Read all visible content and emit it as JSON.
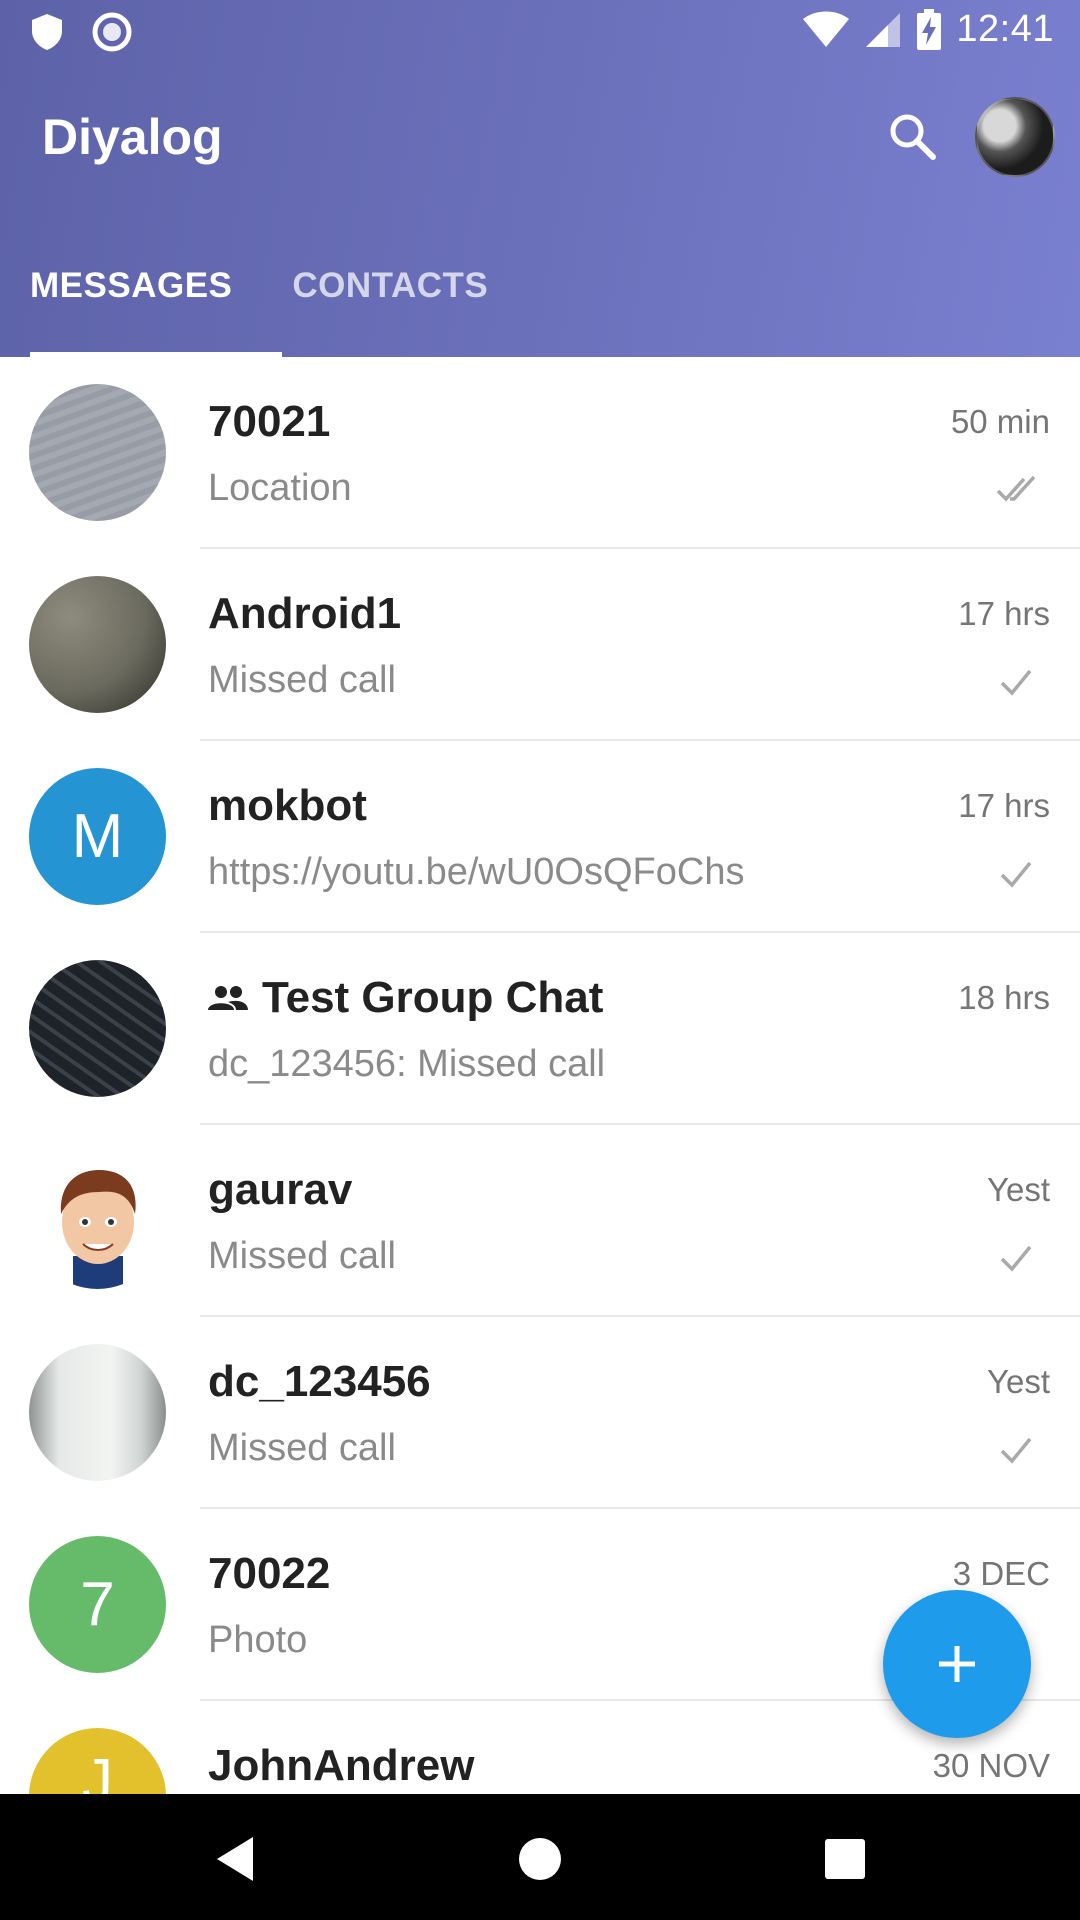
{
  "status_bar": {
    "time": "12:41",
    "left_icons": [
      "shield-icon",
      "record-icon"
    ],
    "right_icons": [
      "wifi-icon",
      "signal-icon",
      "battery-charging-icon"
    ]
  },
  "app_bar": {
    "title": "Diyalog",
    "search_icon": "search-icon",
    "colors": {
      "gradient_start": "#5d62a8",
      "gradient_end": "#7a80d0"
    }
  },
  "tabs": [
    {
      "label": "MESSAGES",
      "active": true
    },
    {
      "label": "CONTACTS",
      "active": false
    }
  ],
  "conversations": [
    {
      "name": "70021",
      "time": "50 min",
      "preview": "Location",
      "status": "double-check",
      "avatar_type": "photo",
      "avatar_letter": "",
      "avatar_color": "#9ea3ad"
    },
    {
      "name": "Android1",
      "time": "17 hrs",
      "preview": "Missed call",
      "status": "check",
      "avatar_type": "photo",
      "avatar_letter": "",
      "avatar_color": "#6b6a5e"
    },
    {
      "name": "mokbot",
      "time": "17 hrs",
      "preview": "https://youtu.be/wU0OsQFoChs",
      "status": "check",
      "avatar_type": "letter",
      "avatar_letter": "M",
      "avatar_color": "#2494d3"
    },
    {
      "name": "Test Group Chat",
      "time": "18 hrs",
      "preview": "dc_123456: Missed call",
      "status": "none",
      "is_group": true,
      "avatar_type": "photo",
      "avatar_letter": "",
      "avatar_color": "#2b2f37"
    },
    {
      "name": "gaurav",
      "time": "Yest",
      "preview": "Missed call",
      "status": "check",
      "avatar_type": "cartoon",
      "avatar_letter": "",
      "avatar_color": "#ffffff"
    },
    {
      "name": "dc_123456",
      "time": "Yest",
      "preview": "Missed call",
      "status": "check",
      "avatar_type": "photo",
      "avatar_letter": "",
      "avatar_color": "#c9cdcc"
    },
    {
      "name": "70022",
      "time": "3 DEC",
      "preview": "Photo",
      "status": "none",
      "avatar_type": "letter",
      "avatar_letter": "7",
      "avatar_color": "#66bb6a"
    },
    {
      "name": "JohnAndrew",
      "time": "30 NOV",
      "preview": "",
      "status": "none",
      "avatar_type": "letter",
      "avatar_letter": "J",
      "avatar_color": "#e3c12c"
    }
  ],
  "fab": {
    "icon": "plus-icon",
    "color": "#1e9bea"
  },
  "nav_bar": {
    "buttons": [
      "back-icon",
      "home-icon",
      "recents-icon"
    ]
  }
}
